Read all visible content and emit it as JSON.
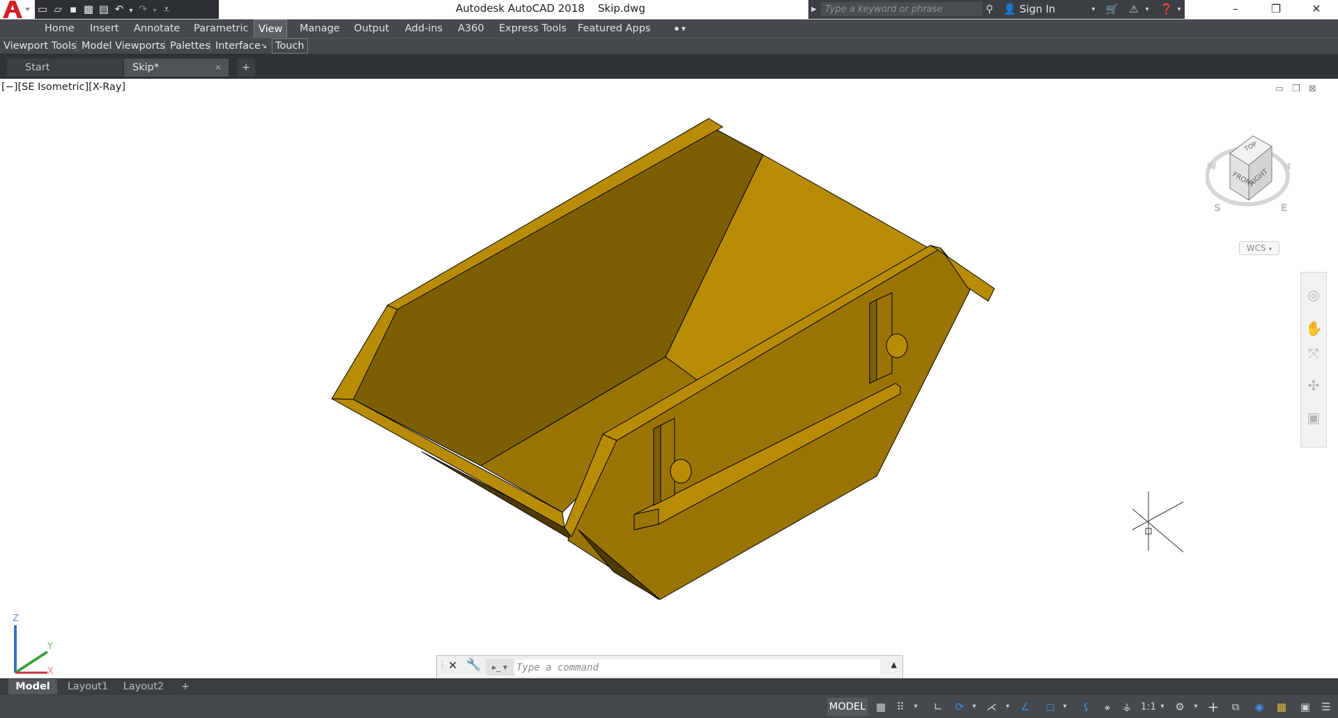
{
  "window": {
    "title": "Autodesk AutoCAD 2018    Skip.dwg",
    "minimize_label": "–",
    "restore_label": "❐",
    "close_label": "✕"
  },
  "search": {
    "placeholder": "Type a keyword or phrase"
  },
  "account": {
    "signin_label": "Sign In"
  },
  "ribbon": {
    "tabs": [
      "Home",
      "Insert",
      "Annotate",
      "Parametric",
      "View",
      "Manage",
      "Output",
      "Add-ins",
      "A360",
      "Express Tools",
      "Featured Apps"
    ],
    "active_tab": "View"
  },
  "panels": {
    "items": [
      "Viewport Tools",
      "Model Viewports",
      "Palettes",
      "Interface",
      "Touch"
    ]
  },
  "file_tabs": {
    "items": [
      "Start",
      "Skip*"
    ],
    "active": "Skip*"
  },
  "viewport": {
    "label": "[−][SE Isometric][X-Ray]"
  },
  "viewcube": {
    "top": "TOP",
    "front": "FRONT",
    "right": "RIGHT",
    "compass_s": "S",
    "compass_e": "E",
    "compass_w": "W",
    "compass_n": "N",
    "wcs_label": "WCS"
  },
  "ucs": {
    "z": "Z",
    "y": "Y",
    "x": "X"
  },
  "command": {
    "placeholder": "Type a command"
  },
  "layout_tabs": {
    "items": [
      "Model",
      "Layout1",
      "Layout2"
    ],
    "active": "Model"
  },
  "status": {
    "model_label": "MODEL",
    "scale": "1:1"
  },
  "colors": {
    "skip_light": "#b88c06",
    "skip_mid": "#9a7404",
    "skip_dark": "#7d5f03",
    "skip_darkest": "#4e3b02",
    "chrome_dark": "#45484c"
  }
}
